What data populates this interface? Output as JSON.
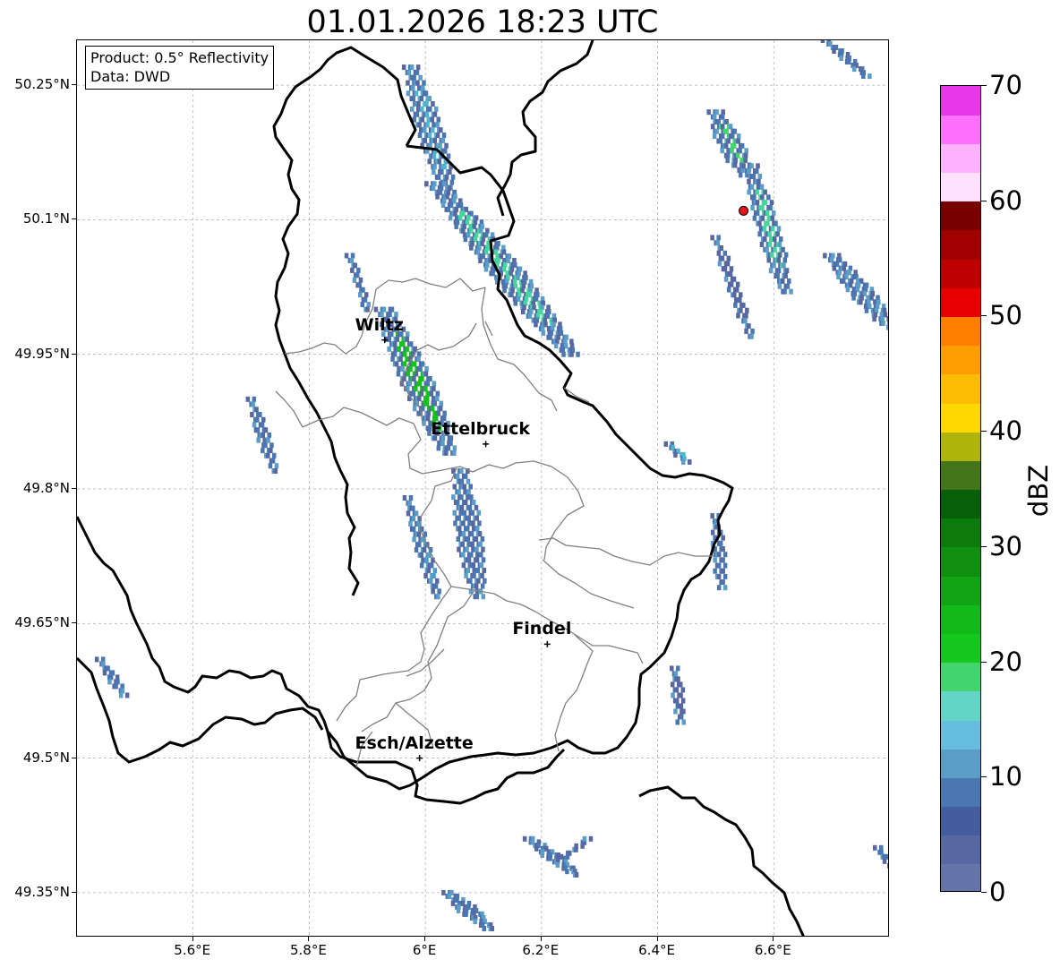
{
  "title": "01.01.2026 18:23 UTC",
  "info_box": {
    "line1": "Product: 0.5° Reflectivity",
    "line2": "Data: DWD"
  },
  "map": {
    "lon_range": [
      5.4,
      6.8
    ],
    "lat_range": [
      49.3,
      50.3
    ],
    "lat_ticks": [
      {
        "value": 50.25,
        "label": "50.25°N"
      },
      {
        "value": 50.1,
        "label": "50.1°N"
      },
      {
        "value": 49.95,
        "label": "49.95°N"
      },
      {
        "value": 49.8,
        "label": "49.8°N"
      },
      {
        "value": 49.65,
        "label": "49.65°N"
      },
      {
        "value": 49.5,
        "label": "49.5°N"
      },
      {
        "value": 49.35,
        "label": "49.35°N"
      }
    ],
    "lon_ticks": [
      {
        "value": 5.6,
        "label": "5.6°E"
      },
      {
        "value": 5.8,
        "label": "5.8°E"
      },
      {
        "value": 6.0,
        "label": "6°E"
      },
      {
        "value": 6.2,
        "label": "6.2°E"
      },
      {
        "value": 6.4,
        "label": "6.4°E"
      },
      {
        "value": 6.6,
        "label": "6.6°E"
      }
    ],
    "grid": true,
    "cities": [
      {
        "name": "Wiltz",
        "lon": 5.93,
        "lat": 49.966
      },
      {
        "name": "Ettelbruck",
        "lon": 6.104,
        "lat": 49.85
      },
      {
        "name": "Findel",
        "lon": 6.21,
        "lat": 49.627
      },
      {
        "name": "Esch/Alzette",
        "lon": 5.99,
        "lat": 49.5
      }
    ],
    "radar_site": {
      "lon": 6.548,
      "lat": 50.11,
      "color": "#e8141c"
    }
  },
  "colorbar": {
    "label": "dBZ",
    "min": 0,
    "max": 70,
    "ticks": [
      "0",
      "10",
      "20",
      "30",
      "40",
      "50",
      "60",
      "70"
    ],
    "colors": [
      "#6473a8",
      "#5667a2",
      "#445d9f",
      "#4a77b2",
      "#5b9dc6",
      "#66bede",
      "#62d5c6",
      "#42d56d",
      "#15c81e",
      "#13b819",
      "#12a414",
      "#108e10",
      "#0c7a0d",
      "#075f09",
      "#45751a",
      "#aeb409",
      "#fed800",
      "#ffbc05",
      "#ff9d00",
      "#ff7e00",
      "#e60000",
      "#bf0000",
      "#a00000",
      "#7a0000",
      "#ffe0ff",
      "#ffb2ff",
      "#ff70ff",
      "#e637e8"
    ]
  },
  "echoes": [
    {
      "lon1": 5.975,
      "lat1": 50.27,
      "lon2": 6.04,
      "lat2": 50.13,
      "width": 0.045,
      "peak": "#4fb5cf"
    },
    {
      "lon1": 6.02,
      "lat1": 50.14,
      "lon2": 6.25,
      "lat2": 49.95,
      "width": 0.06,
      "peak": "#45d6a0"
    },
    {
      "lon1": 5.93,
      "lat1": 50.0,
      "lon2": 6.04,
      "lat2": 49.84,
      "width": 0.055,
      "peak": "#14c21c"
    },
    {
      "lon1": 5.97,
      "lat1": 49.79,
      "lon2": 6.02,
      "lat2": 49.68,
      "width": 0.025,
      "peak": "#4a9dc9"
    },
    {
      "lon1": 6.06,
      "lat1": 49.82,
      "lon2": 6.09,
      "lat2": 49.68,
      "width": 0.045,
      "peak": "#4a77b2"
    },
    {
      "lon1": 5.7,
      "lat1": 49.9,
      "lon2": 5.74,
      "lat2": 49.82,
      "width": 0.022,
      "peak": "#4a77b2"
    },
    {
      "lon1": 6.5,
      "lat1": 50.22,
      "lon2": 6.55,
      "lat2": 50.15,
      "width": 0.045,
      "peak": "#42d56d"
    },
    {
      "lon1": 6.56,
      "lat1": 50.16,
      "lon2": 6.62,
      "lat2": 50.02,
      "width": 0.04,
      "peak": "#45d6a0"
    },
    {
      "lon1": 6.5,
      "lat1": 50.08,
      "lon2": 6.56,
      "lat2": 49.97,
      "width": 0.02,
      "peak": "#5667a2"
    },
    {
      "lon1": 6.7,
      "lat1": 50.06,
      "lon2": 6.8,
      "lat2": 49.98,
      "width": 0.045,
      "peak": "#5b9dc6"
    },
    {
      "lon1": 6.69,
      "lat1": 50.3,
      "lon2": 6.76,
      "lat2": 50.26,
      "width": 0.02,
      "peak": "#4a77b2"
    },
    {
      "lon1": 5.87,
      "lat1": 50.06,
      "lon2": 5.9,
      "lat2": 50.0,
      "width": 0.012,
      "peak": "#4a77b2"
    },
    {
      "lon1": 6.42,
      "lat1": 49.85,
      "lon2": 6.45,
      "lat2": 49.83,
      "width": 0.018,
      "peak": "#4fb5cf"
    },
    {
      "lon1": 6.5,
      "lat1": 49.77,
      "lon2": 6.51,
      "lat2": 49.69,
      "width": 0.022,
      "peak": "#4a77b2"
    },
    {
      "lon1": 6.43,
      "lat1": 49.6,
      "lon2": 6.44,
      "lat2": 49.54,
      "width": 0.02,
      "peak": "#5667a2"
    },
    {
      "lon1": 5.44,
      "lat1": 49.61,
      "lon2": 5.48,
      "lat2": 49.57,
      "width": 0.02,
      "peak": "#4a77b2"
    },
    {
      "lon1": 6.18,
      "lat1": 49.41,
      "lon2": 6.26,
      "lat2": 49.37,
      "width": 0.03,
      "peak": "#4a77b2"
    },
    {
      "lon1": 6.04,
      "lat1": 49.35,
      "lon2": 6.11,
      "lat2": 49.31,
      "width": 0.035,
      "peak": "#4a77b2"
    },
    {
      "lon1": 6.24,
      "lat1": 49.39,
      "lon2": 6.28,
      "lat2": 49.41,
      "width": 0.015,
      "peak": "#5667a2"
    },
    {
      "lon1": 6.78,
      "lat1": 49.4,
      "lon2": 6.8,
      "lat2": 49.38,
      "width": 0.018,
      "peak": "#4a77b2"
    }
  ]
}
